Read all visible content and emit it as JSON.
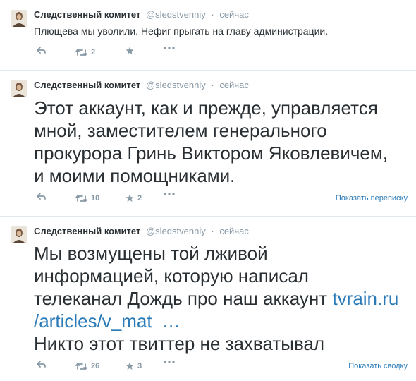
{
  "tweets": [
    {
      "fullname": "Следственный комитет",
      "username": "@sledstvenniy",
      "separator": "·",
      "time": "сейчас",
      "text": "Плющева мы уволили. Нефиг прыгать на главу администрации.",
      "retweets": "2",
      "favorites": "",
      "expand_label": ""
    },
    {
      "fullname": "Следственный комитет",
      "username": "@sledstvenniy",
      "separator": "·",
      "time": "сейчас",
      "text_lines": [
        "Этот аккаунт, как и прежде, управляется",
        "мной, заместителем генерального",
        "прокурора Гринь Виктором Яковлевичем,",
        "и моими помощниками."
      ],
      "retweets": "10",
      "favorites": "2",
      "expand_label": "Показать переписку"
    },
    {
      "fullname": "Следственный комитет",
      "username": "@sledstvenniy",
      "separator": "·",
      "time": "сейчас",
      "text_lines": [
        "Мы возмущены той лживой",
        "информацией, которую написал",
        "телеканал Дождь про наш аккаунт"
      ],
      "link_part1": "tvrain.ru",
      "link_part2": "/articles/v_mat",
      "ellipsis": "…",
      "text_last": "Никто этот твиттер не захватывал",
      "retweets": "26",
      "favorites": "3",
      "expand_label": "Показать сводку"
    }
  ],
  "icons": {
    "reply": "reply-icon",
    "retweet": "retweet-icon",
    "favorite": "star-icon",
    "more": "more-icon"
  },
  "colors": {
    "link": "#2b7bb9",
    "muted": "#8899a6",
    "text": "#292f33",
    "divider": "#e1e8ed"
  }
}
